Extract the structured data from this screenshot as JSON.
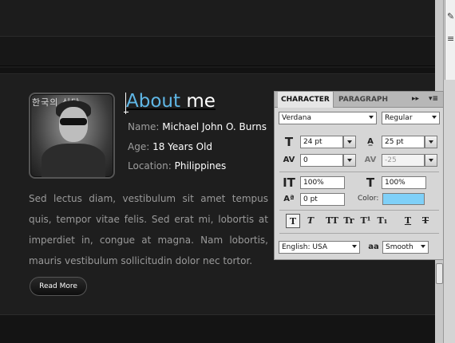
{
  "profile": {
    "heading_accent": "About",
    "heading_rest": "me",
    "name_label": "Name:",
    "name_value": "Michael John O. Burns",
    "age_label": "Age:",
    "age_value": "18 Years Old",
    "location_label": "Location:",
    "location_value": "Philippines",
    "bio": "Sed lectus diam, vestibulum sit amet tempus quis, tempor vitae felis. Sed erat mi, lobortis at imperdiet in, congue at magna. Nam lobortis, mauris vestibulum sollicitudin  dolor nec tortor.",
    "read_more": "Read More",
    "avatar_sign": "한국의 식당"
  },
  "character_panel": {
    "tab_character": "CHARACTER",
    "tab_paragraph": "PARAGRAPH",
    "collapse_glyph": "▸▸",
    "menu_glyph": "▾≡",
    "font_family": "Verdana",
    "font_style": "Regular",
    "font_size": "24 pt",
    "leading": "25 pt",
    "kerning": "0",
    "tracking": "-25",
    "vertical_scale": "100%",
    "horizontal_scale": "100%",
    "baseline_shift": "0 pt",
    "color_label": "Color:",
    "color_value": "#7fd0f8",
    "language": "English: USA",
    "antialias_label": "a",
    "antialias": "Smooth",
    "type_buttons": [
      "T",
      "T",
      "TT",
      "Tr",
      "T¹",
      "T₁",
      "T",
      "T"
    ]
  },
  "icons": [
    "font-size-icon",
    "leading-icon",
    "kerning-icon",
    "tracking-icon",
    "vertical-scale-icon",
    "horizontal-scale-icon",
    "baseline-shift-icon",
    "antialias-icon"
  ]
}
